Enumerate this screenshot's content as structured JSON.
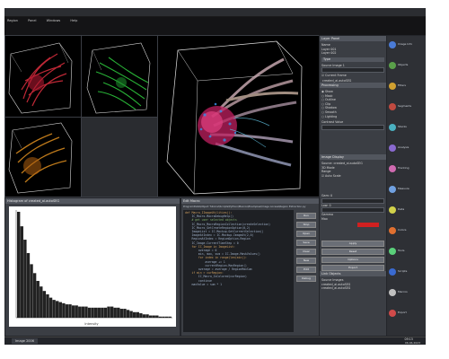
{
  "menu": [
    "Region",
    "Panel",
    "Windows",
    "Help"
  ],
  "viewports": {
    "red_view": "red",
    "green_view": "green",
    "orange_view": "orange",
    "main_view": "3D render"
  },
  "histogram": {
    "title": "Histogram of created_ai.autoSEG",
    "xlabel": "Intensity",
    "bins": [
      95,
      82,
      70,
      58,
      48,
      40,
      33,
      28,
      24,
      21,
      18,
      16,
      15,
      14,
      13,
      12,
      12,
      11,
      11,
      10,
      10,
      10,
      9,
      9,
      9,
      9,
      9,
      9,
      10,
      10,
      9,
      9,
      8,
      8,
      7,
      6,
      5,
      5,
      4,
      3,
      3,
      2,
      2,
      2,
      1,
      1,
      1,
      1
    ]
  },
  "editor": {
    "title": "Edit Macro",
    "path": "ProgramData\\Object Tutorial\\Scripts\\Python\\Macros\\Examples\\Image Access\\Region Extraction.py",
    "lines": [
      "def Macro_IImageUtilities():",
      "    IC_Macro.MacroDebugHelp()",
      "",
      "    # get user selected objects",
      "    IC_Macro_MacroRegionCollection(createSelection)",
      "    IC_Macro_GetCreateRegionOption(0,2)",
      "",
      "    ImageList = IC.Mockup.GetCurrentSelection()",
      "    ImageAtIndex = IC.Mockup.ImageAt(2,0)",
      "    RegionAtIndex = RegionOption.Region",
      "",
      "    IC_Image.CurrentTimeStep = 0",
      "",
      "    for IC_Image in ImageList:",
      "        average = 0",
      "        min, max, sum = IC.Image.MaskValues()",
      "        for index in range(len(min)):",
      "            average += 1",
      "            currentRegion.MaxRegion()",
      "        average = average / RegionMaxSum",
      "",
      "    if min > curRegion:",
      "        IC_Macro_IsColored(curRegion)",
      "        continue",
      "    maxValue = sum * 1"
    ],
    "buttons": [
      "Run",
      "Stop",
      "Open",
      "Save",
      "Clear",
      "New",
      "Edit",
      "Debug"
    ]
  },
  "right_panel": {
    "title": "Layer Panel",
    "rows": [
      "Name",
      "Layer 001",
      "Layer 002",
      "Type",
      "Source Image 1",
      "created_ai.autoSEG"
    ],
    "checkbox_label": "Current Frame",
    "section2_title": "Processing",
    "options": [
      "Show",
      "Mask",
      "Outline",
      "Clip",
      "Shadow",
      "Smooth",
      "Lighting"
    ],
    "field_label": "Contrast Value",
    "section3_title": "Image Display",
    "section3_rows": [
      "Source: created_ai.autoSEG",
      "3D Mode",
      "Range",
      "Auto Scale"
    ],
    "numeric_rows": [
      "Gam: 0",
      "Low: 0",
      "Gamma",
      "Max"
    ],
    "buttons": [
      "Apply",
      "Reset",
      "Options",
      "Export"
    ],
    "bottom_title": "Link Objects",
    "bottom_rows": [
      "Source Images",
      "created_ai.autoSEG",
      "created_ai.autoSEG"
    ]
  },
  "tool_strip": {
    "labels": [
      "Image Info",
      "Objects",
      "Filters",
      "Segments",
      "Stacks",
      "Analysis",
      "Tracking",
      "Measure",
      "Data",
      "Colors",
      "Tools",
      "Scripts",
      "Macros",
      "Export"
    ],
    "colors": [
      "#4a7bd6",
      "#5aa04a",
      "#d0a030",
      "#c04a40",
      "#4ab0c0",
      "#8a6ad0",
      "#d06ab0",
      "#70a0e0",
      "#d0d04a",
      "#e07030",
      "#5ad07a",
      "#3a6ad0",
      "#c0c0c0",
      "#d04a4a"
    ]
  },
  "taskbar": {
    "start": "Image 2006",
    "clock": "09:15",
    "date": "06.06.2023"
  },
  "accent": "#5b8fd8"
}
